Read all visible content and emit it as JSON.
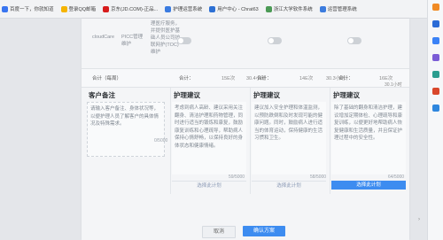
{
  "bookmarks": [
    {
      "label": "百度一下，你就知道",
      "color": "#3975f0"
    },
    {
      "label": "登录QQ邮箱",
      "color": "#f5b400"
    },
    {
      "label": "京东(JD.COM)-正品...",
      "color": "#d71c1c"
    },
    {
      "label": "护理运营系统",
      "color": "#3a7be0"
    },
    {
      "label": "用户中心 - Chrat63",
      "color": "#2d70d4"
    },
    {
      "label": "浙江大学软件系统",
      "color": "#4b9a55"
    },
    {
      "label": "运营管理系统",
      "color": "#3c7cde"
    }
  ],
  "rail_icons": [
    {
      "name": "extension-icon",
      "color": "#f08a24"
    },
    {
      "name": "outlook-icon",
      "color": "#2b6bd6"
    },
    {
      "name": "shield-icon",
      "color": "#3b82f6"
    },
    {
      "name": "games-icon",
      "color": "#7b5cd6"
    },
    {
      "name": "puzzle-icon",
      "color": "#2a9d8f"
    },
    {
      "name": "office-icon",
      "color": "#d9472b"
    },
    {
      "name": "send-icon",
      "color": "#2e86de"
    }
  ],
  "table": {
    "row_name": "cloudCare",
    "row_service": "PICC管理维护",
    "row_desc": "理医疗服务，并提供医护基础人员公司护联网护(TOC)维护",
    "summary_label": "合计（每周）",
    "totals": [
      {
        "label": "合计：",
        "count": "15E次",
        "time": "30.4小时"
      },
      {
        "label": "合计：",
        "count": "14E次",
        "time": "30.3小时"
      },
      {
        "label": "合计：",
        "count": "16E次",
        "time": "30.1小时"
      }
    ]
  },
  "customer_note": {
    "title": "客户备注",
    "placeholder_text": "请输入客户备注、身体状况等，以便护理人员了解客户的具体情况及特殊需求。",
    "counter": "0/5000"
  },
  "care_suggestions": [
    {
      "title": "护理建议",
      "text": "考虑到病人高龄、建议采用关注翻身、清洁护理和药物管理，同时进行适当的锻炼和康复，鼓励康复训练和心理疏导，帮助病人保持心情舒畅，以保持良好的身体状态和健康情绪。",
      "counter": "59/5000",
      "button": "选择此计划",
      "selected": false
    },
    {
      "title": "护理建议",
      "text": "建议加入安全护理和体温监测，以预防跌倒和及时发现可能的健康问题。同时，鼓励病人进行适当的体育运动，保持健康的生活习惯和卫生。",
      "counter": "58/5000",
      "button": "选择此计划",
      "selected": false
    },
    {
      "title": "护理建议",
      "text": "除了基础的翻身和清洁护理，建议增加定期体检、心理疏导和康复训练，以便更好地帮助病人恢复健康和生活质量，并且保证护理过程中的安全性。",
      "counter": "64/5000",
      "button": "选择此计划",
      "selected": true
    }
  ],
  "footer": {
    "cancel": "取消",
    "confirm": "确认方案"
  }
}
